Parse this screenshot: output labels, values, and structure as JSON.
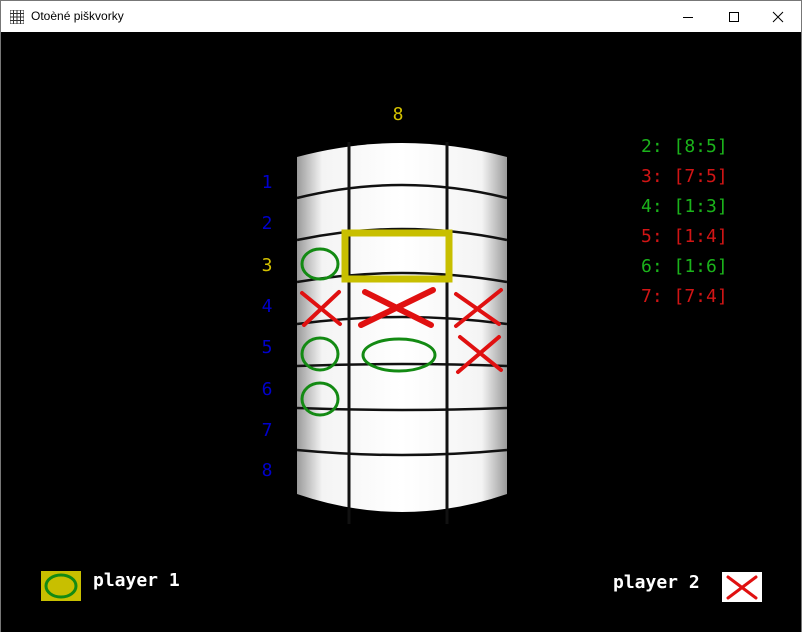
{
  "window": {
    "title": "Otoèné piškvorky"
  },
  "board": {
    "column_label": "8",
    "row_labels": [
      "1",
      "2",
      "3",
      "4",
      "5",
      "6",
      "7",
      "8"
    ],
    "active_row": 3
  },
  "moves": [
    {
      "text": "2: [8:5]",
      "color": "#1bb31b"
    },
    {
      "text": "3: [7:5]",
      "color": "#d11515"
    },
    {
      "text": "4: [1:3]",
      "color": "#1bb31b"
    },
    {
      "text": "5: [1:4]",
      "color": "#d11515"
    },
    {
      "text": "6: [1:6]",
      "color": "#1bb31b"
    },
    {
      "text": "7: [7:4]",
      "color": "#d11515"
    }
  ],
  "players": {
    "player1": {
      "label": "player 1",
      "symbol": "O",
      "color": "#138a13"
    },
    "player2": {
      "label": "player 2",
      "symbol": "X",
      "color": "#e01010"
    }
  },
  "colors": {
    "highlight": "#c8bf00",
    "o_color": "#138a13",
    "x_color": "#e01010"
  }
}
